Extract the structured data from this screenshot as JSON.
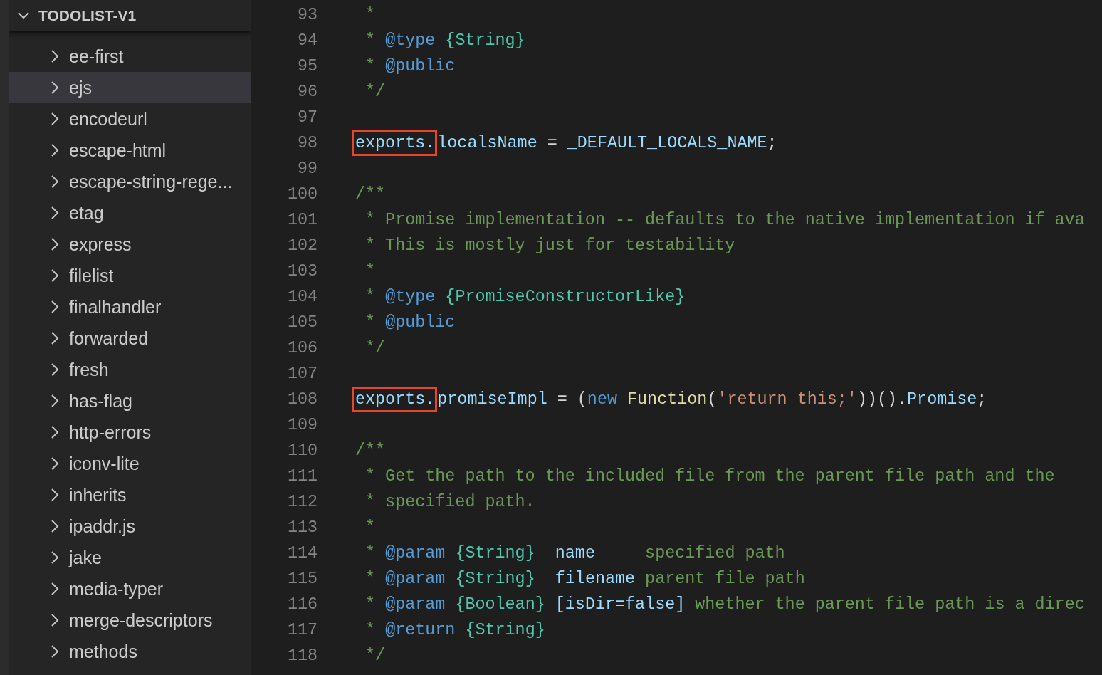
{
  "explorer": {
    "title": "TODOLIST-V1",
    "expanded": true,
    "items": [
      {
        "label": "ee-first",
        "selected": false,
        "expanded": false
      },
      {
        "label": "ejs",
        "selected": true,
        "expanded": false
      },
      {
        "label": "encodeurl",
        "selected": false,
        "expanded": false
      },
      {
        "label": "escape-html",
        "selected": false,
        "expanded": false
      },
      {
        "label": "escape-string-rege...",
        "selected": false,
        "expanded": false
      },
      {
        "label": "etag",
        "selected": false,
        "expanded": false
      },
      {
        "label": "express",
        "selected": false,
        "expanded": false
      },
      {
        "label": "filelist",
        "selected": false,
        "expanded": false
      },
      {
        "label": "finalhandler",
        "selected": false,
        "expanded": false
      },
      {
        "label": "forwarded",
        "selected": false,
        "expanded": false
      },
      {
        "label": "fresh",
        "selected": false,
        "expanded": false
      },
      {
        "label": "has-flag",
        "selected": false,
        "expanded": false
      },
      {
        "label": "http-errors",
        "selected": false,
        "expanded": false
      },
      {
        "label": "iconv-lite",
        "selected": false,
        "expanded": false
      },
      {
        "label": "inherits",
        "selected": false,
        "expanded": false
      },
      {
        "label": "ipaddr.js",
        "selected": false,
        "expanded": false
      },
      {
        "label": "jake",
        "selected": false,
        "expanded": false
      },
      {
        "label": "media-typer",
        "selected": false,
        "expanded": false
      },
      {
        "label": "merge-descriptors",
        "selected": false,
        "expanded": false
      },
      {
        "label": "methods",
        "selected": false,
        "expanded": false
      }
    ]
  },
  "editor": {
    "lines": [
      {
        "number": "93",
        "tokens": [
          {
            "kind": "comment",
            "text": " *"
          }
        ]
      },
      {
        "number": "94",
        "tokens": [
          {
            "kind": "comment",
            "text": " * "
          },
          {
            "kind": "tag",
            "text": "@type "
          },
          {
            "kind": "type",
            "text": "{String}"
          }
        ]
      },
      {
        "number": "95",
        "tokens": [
          {
            "kind": "comment",
            "text": " * "
          },
          {
            "kind": "tag",
            "text": "@public"
          }
        ]
      },
      {
        "number": "96",
        "tokens": [
          {
            "kind": "comment",
            "text": " */"
          }
        ]
      },
      {
        "number": "97"
      },
      {
        "number": "98",
        "tokens": [
          {
            "kind": "variable",
            "text": "exports.",
            "boxed": true
          },
          {
            "kind": "variable",
            "text": "localsName"
          },
          {
            "kind": "plain",
            "text": " = "
          },
          {
            "kind": "variable",
            "text": "_DEFAULT_LOCALS_NAME"
          },
          {
            "kind": "plain",
            "text": ";"
          }
        ]
      },
      {
        "number": "99"
      },
      {
        "number": "100",
        "tokens": [
          {
            "kind": "comment",
            "text": "/**"
          }
        ]
      },
      {
        "number": "101",
        "tokens": [
          {
            "kind": "comment",
            "text": " * Promise implementation -- defaults to the native implementation if ava"
          }
        ]
      },
      {
        "number": "102",
        "tokens": [
          {
            "kind": "comment",
            "text": " * This is mostly just for testability"
          }
        ]
      },
      {
        "number": "103",
        "tokens": [
          {
            "kind": "comment",
            "text": " *"
          }
        ]
      },
      {
        "number": "104",
        "tokens": [
          {
            "kind": "comment",
            "text": " * "
          },
          {
            "kind": "tag",
            "text": "@type "
          },
          {
            "kind": "type",
            "text": "{PromiseConstructorLike}"
          }
        ]
      },
      {
        "number": "105",
        "tokens": [
          {
            "kind": "comment",
            "text": " * "
          },
          {
            "kind": "tag",
            "text": "@public"
          }
        ]
      },
      {
        "number": "106",
        "tokens": [
          {
            "kind": "comment",
            "text": " */"
          }
        ]
      },
      {
        "number": "107"
      },
      {
        "number": "108",
        "tokens": [
          {
            "kind": "variable",
            "text": "exports.",
            "boxed": true
          },
          {
            "kind": "variable",
            "text": "promiseImpl"
          },
          {
            "kind": "plain",
            "text": " = ("
          },
          {
            "kind": "keyword",
            "text": "new "
          },
          {
            "kind": "function",
            "text": "Function"
          },
          {
            "kind": "plain",
            "text": "("
          },
          {
            "kind": "string",
            "text": "'return this;'"
          },
          {
            "kind": "plain",
            "text": "))()."
          },
          {
            "kind": "variable",
            "text": "Promise"
          },
          {
            "kind": "plain",
            "text": ";"
          }
        ]
      },
      {
        "number": "109"
      },
      {
        "number": "110",
        "tokens": [
          {
            "kind": "comment",
            "text": "/**"
          }
        ]
      },
      {
        "number": "111",
        "tokens": [
          {
            "kind": "comment",
            "text": " * Get the path to the included file from the parent file path and the"
          }
        ]
      },
      {
        "number": "112",
        "tokens": [
          {
            "kind": "comment",
            "text": " * specified path."
          }
        ]
      },
      {
        "number": "113",
        "tokens": [
          {
            "kind": "comment",
            "text": " *"
          }
        ]
      },
      {
        "number": "114",
        "tokens": [
          {
            "kind": "comment",
            "text": " * "
          },
          {
            "kind": "tag",
            "text": "@param "
          },
          {
            "kind": "type",
            "text": "{String}  "
          },
          {
            "kind": "variable",
            "text": "name"
          },
          {
            "kind": "comment",
            "text": "     specified path"
          }
        ]
      },
      {
        "number": "115",
        "tokens": [
          {
            "kind": "comment",
            "text": " * "
          },
          {
            "kind": "tag",
            "text": "@param "
          },
          {
            "kind": "type",
            "text": "{String}  "
          },
          {
            "kind": "variable",
            "text": "filename"
          },
          {
            "kind": "comment",
            "text": " parent file path"
          }
        ]
      },
      {
        "number": "116",
        "tokens": [
          {
            "kind": "comment",
            "text": " * "
          },
          {
            "kind": "tag",
            "text": "@param "
          },
          {
            "kind": "type",
            "text": "{Boolean} "
          },
          {
            "kind": "variable",
            "text": "[isDir=false]"
          },
          {
            "kind": "comment",
            "text": " whether the parent file path is a direc"
          }
        ]
      },
      {
        "number": "117",
        "tokens": [
          {
            "kind": "comment",
            "text": " * "
          },
          {
            "kind": "tag",
            "text": "@return "
          },
          {
            "kind": "type",
            "text": "{String}"
          }
        ]
      },
      {
        "number": "118",
        "tokens": [
          {
            "kind": "comment",
            "text": " */"
          }
        ]
      }
    ]
  }
}
